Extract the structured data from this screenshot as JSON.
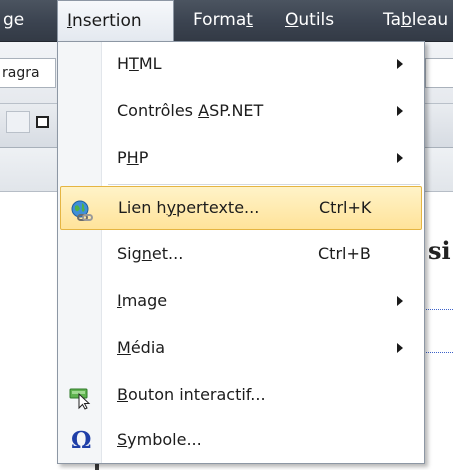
{
  "menubar": {
    "items": [
      {
        "label": "ge"
      },
      {
        "label_parts": [
          "",
          "I",
          "nsertion"
        ]
      },
      {
        "label_parts": [
          "Forma",
          "t",
          ""
        ]
      },
      {
        "label_parts": [
          "",
          "O",
          "utils"
        ]
      },
      {
        "label_parts": [
          "Ta",
          "b",
          "leau"
        ]
      }
    ]
  },
  "toolbar": {
    "paragraph_combo_value": "ragra"
  },
  "document": {
    "heading_fragment": "si"
  },
  "menu": {
    "items": [
      {
        "parts": [
          "H",
          "T",
          "ML"
        ],
        "submenu": true
      },
      {
        "parts": [
          "Contrôles ",
          "A",
          "SP.NET"
        ],
        "submenu": true
      },
      {
        "parts": [
          "P",
          "H",
          "P"
        ],
        "submenu": true
      },
      {
        "parts": [
          "Lien h",
          "y",
          "pertexte..."
        ],
        "shortcut": "Ctrl+K",
        "icon": "hyperlink-globe-icon",
        "highlighted": true
      },
      {
        "parts": [
          "Sig",
          "n",
          "et..."
        ],
        "shortcut": "Ctrl+B"
      },
      {
        "parts": [
          "",
          "I",
          "mage"
        ],
        "submenu": true
      },
      {
        "parts": [
          "",
          "M",
          "édia"
        ],
        "submenu": true
      },
      {
        "parts": [
          "",
          "B",
          "outon interactif..."
        ],
        "icon": "interactive-button-icon"
      },
      {
        "parts": [
          "",
          "S",
          "ymbole..."
        ],
        "icon": "omega-symbol-icon"
      }
    ]
  },
  "colors": {
    "menubar_bg": "#3b4350",
    "highlight_bg": "#ffe39a",
    "highlight_border": "#e5b542",
    "symbol_icon": "#1f3fa8"
  }
}
